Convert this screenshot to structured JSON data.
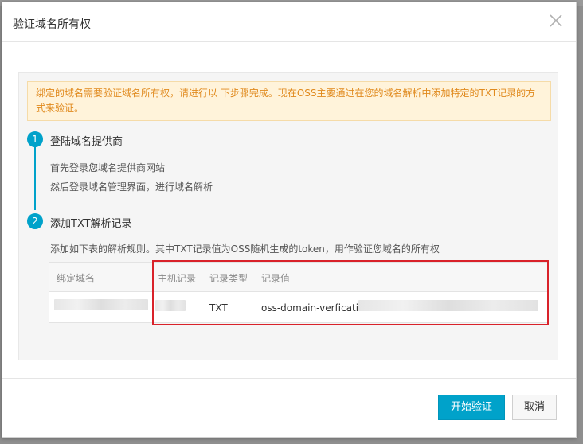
{
  "dialog": {
    "title": "验证域名所有权",
    "close_icon": "close-icon"
  },
  "notice": {
    "text": "绑定的域名需要验证域名所有权，请进行以 下步骤完成。现在OSS主要通过在您的域名解析中添加特定的TXT记录的方式来验证。"
  },
  "steps": [
    {
      "number": "1",
      "title": "登陆域名提供商",
      "lines": [
        "首先登录您域名提供商网站",
        "然后登录域名管理界面，进行域名解析"
      ]
    },
    {
      "number": "2",
      "title": "添加TXT解析记录",
      "lines": [
        "添加如下表的解析规则。其中TXT记录值为OSS随机生成的token，用作验证您域名的所有权"
      ]
    }
  ],
  "table": {
    "headers": [
      "绑定域名",
      "主机记录",
      "记录类型",
      "记录值"
    ],
    "row": {
      "type": "TXT",
      "value_prefix": "oss-domain-verfication"
    }
  },
  "footer": {
    "primary_label": "开始验证",
    "cancel_label": "取消"
  },
  "colors": {
    "accent": "#00a2ca",
    "notice_text": "#e08a1e",
    "notice_bg": "#fff3da",
    "highlight": "#d9222a"
  }
}
